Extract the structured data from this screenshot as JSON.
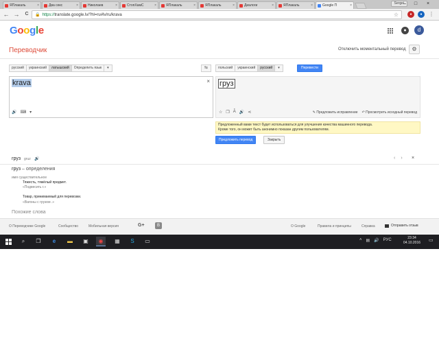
{
  "browser": {
    "tabs": [
      {
        "title": "ЯПлакаль"
      },
      {
        "title": "Два секс"
      },
      {
        "title": "Николаев"
      },
      {
        "title": "СтопХамС"
      },
      {
        "title": "ЯПлакаль"
      },
      {
        "title": "ЯПлакаль"
      },
      {
        "title": "Диалоги"
      },
      {
        "title": "ЯПлакаль"
      },
      {
        "title": "Google П",
        "active": true
      }
    ],
    "profile_name": "Sergei",
    "window_controls": {
      "minimize": "–",
      "maximize": "□",
      "close": "×"
    },
    "url_secure": "https://",
    "url_rest": "translate.google.lv/?hl=ru#lv/ru/krava",
    "icons": {
      "back": "←",
      "forward": "→",
      "reload": "C",
      "bookmark": "☆"
    }
  },
  "header": {
    "logo_letters": [
      {
        "char": "G",
        "color": "#4285f4"
      },
      {
        "char": "o",
        "color": "#ea4335"
      },
      {
        "char": "o",
        "color": "#fbbc05"
      },
      {
        "char": "g",
        "color": "#4285f4"
      },
      {
        "char": "l",
        "color": "#34a853"
      },
      {
        "char": "e",
        "color": "#ea4335"
      }
    ],
    "avatar_letter": "d",
    "bell_glyph": "●"
  },
  "product": {
    "title": "Переводчик",
    "instant_toggle": "Отключить моментальный перевод",
    "settings_glyph": "⚙"
  },
  "source_langs": [
    "русский",
    "украинский",
    "латышский",
    "Определить язык"
  ],
  "target_langs": [
    "польский",
    "украинский",
    "русский"
  ],
  "arrow_glyph": "▾",
  "swap_glyph": "⇆",
  "translate_button": "Перевести",
  "source_text": "krava",
  "result_text": "груз",
  "result_links": {
    "suggest": "Предложить исправление",
    "original": "Просмотреть исходный перевод"
  },
  "notice": {
    "line1": "Предложенный вами текст будет использоваться для улучшения качества машинного перевода.",
    "line2": "Кроме того, он может быть анонимно показан другим пользователям."
  },
  "suggest_button": "Предложить перевод",
  "close_button": "Закрыть",
  "dictionary": {
    "word": "груз",
    "translit": "gruz",
    "def_word": "груз",
    "def_suffix": " – определения",
    "part_of_speech": "имя существительное",
    "senses": [
      {
        "meaning": "Тяжесть, тяжёлый предмет.",
        "example": "«Подвесить г.»"
      },
      {
        "meaning": "Товар, принимаемый для перевозки.",
        "example": "«Вагоны с грузом .»"
      }
    ],
    "similar_title": "Похожие слова"
  },
  "footer": {
    "links": [
      "О Переводчике Google",
      "Сообщество",
      "Мобильная версия"
    ],
    "right_links": [
      "О Google",
      "Правила и принципы",
      "Справка"
    ],
    "gplus": "G+",
    "blogger": "B",
    "feedback": "Отправить отзыв"
  },
  "taskbar": {
    "lang": "РУС",
    "time": "23:34",
    "date": "04.10.2016"
  }
}
